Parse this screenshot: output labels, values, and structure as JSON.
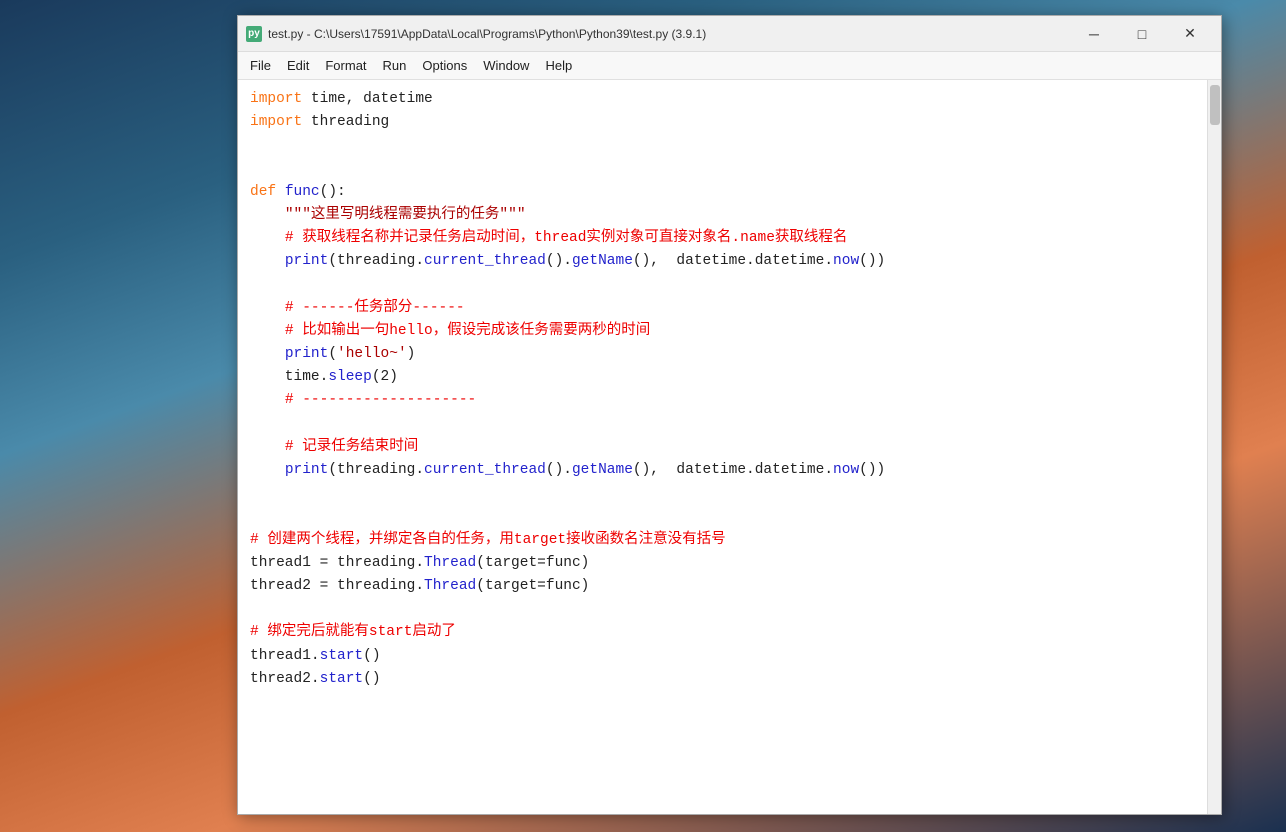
{
  "window": {
    "title": "test.py - C:\\Users\\17591\\AppData\\Local\\Programs\\Python\\Python39\\test.py (3.9.1)",
    "icon_label": "py"
  },
  "menu": {
    "items": [
      "File",
      "Edit",
      "Format",
      "Run",
      "Options",
      "Window",
      "Help"
    ]
  },
  "controls": {
    "minimize": "─",
    "maximize": "□",
    "close": "✕"
  }
}
